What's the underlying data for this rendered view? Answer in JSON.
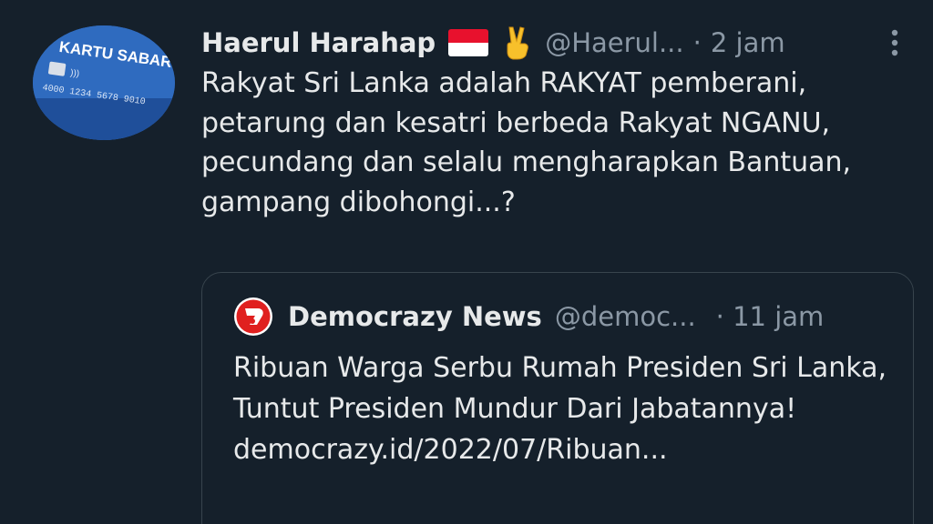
{
  "tweet": {
    "author_name": "Haerul Harahap",
    "author_handle": "@Haerul...",
    "separator": "·",
    "time": "2 jam",
    "avatar_text": "KARTU SABAR",
    "avatar_number": "4000 1234 5678 9010",
    "text": "Rakyat Sri Lanka adalah RAKYAT pemberani, petarung dan kesatri berbeda Rakyat NGANU, pecundang dan selalu mengharapkan Bantuan, gampang dibohongi...?",
    "emoji": [
      "indonesia-flag",
      "victory-hand"
    ],
    "more_icon": "more-vertical-icon"
  },
  "quoted": {
    "author_name": "Democrazy News",
    "author_handle": "@democ...",
    "separator": "·",
    "time": "11 jam",
    "text": "Ribuan Warga Serbu Rumah Presiden Sri Lanka, Tuntut Presiden Mundur Dari Jabatannya!",
    "link": "democrazy.id/2022/07/Ribuan...",
    "logo_icon": "democrazy-logo-icon"
  },
  "colors": {
    "background": "#15202b",
    "text": "#e7e9ea",
    "muted": "#8b98a5",
    "border": "#38444d",
    "logo_red": "#e0201f"
  }
}
